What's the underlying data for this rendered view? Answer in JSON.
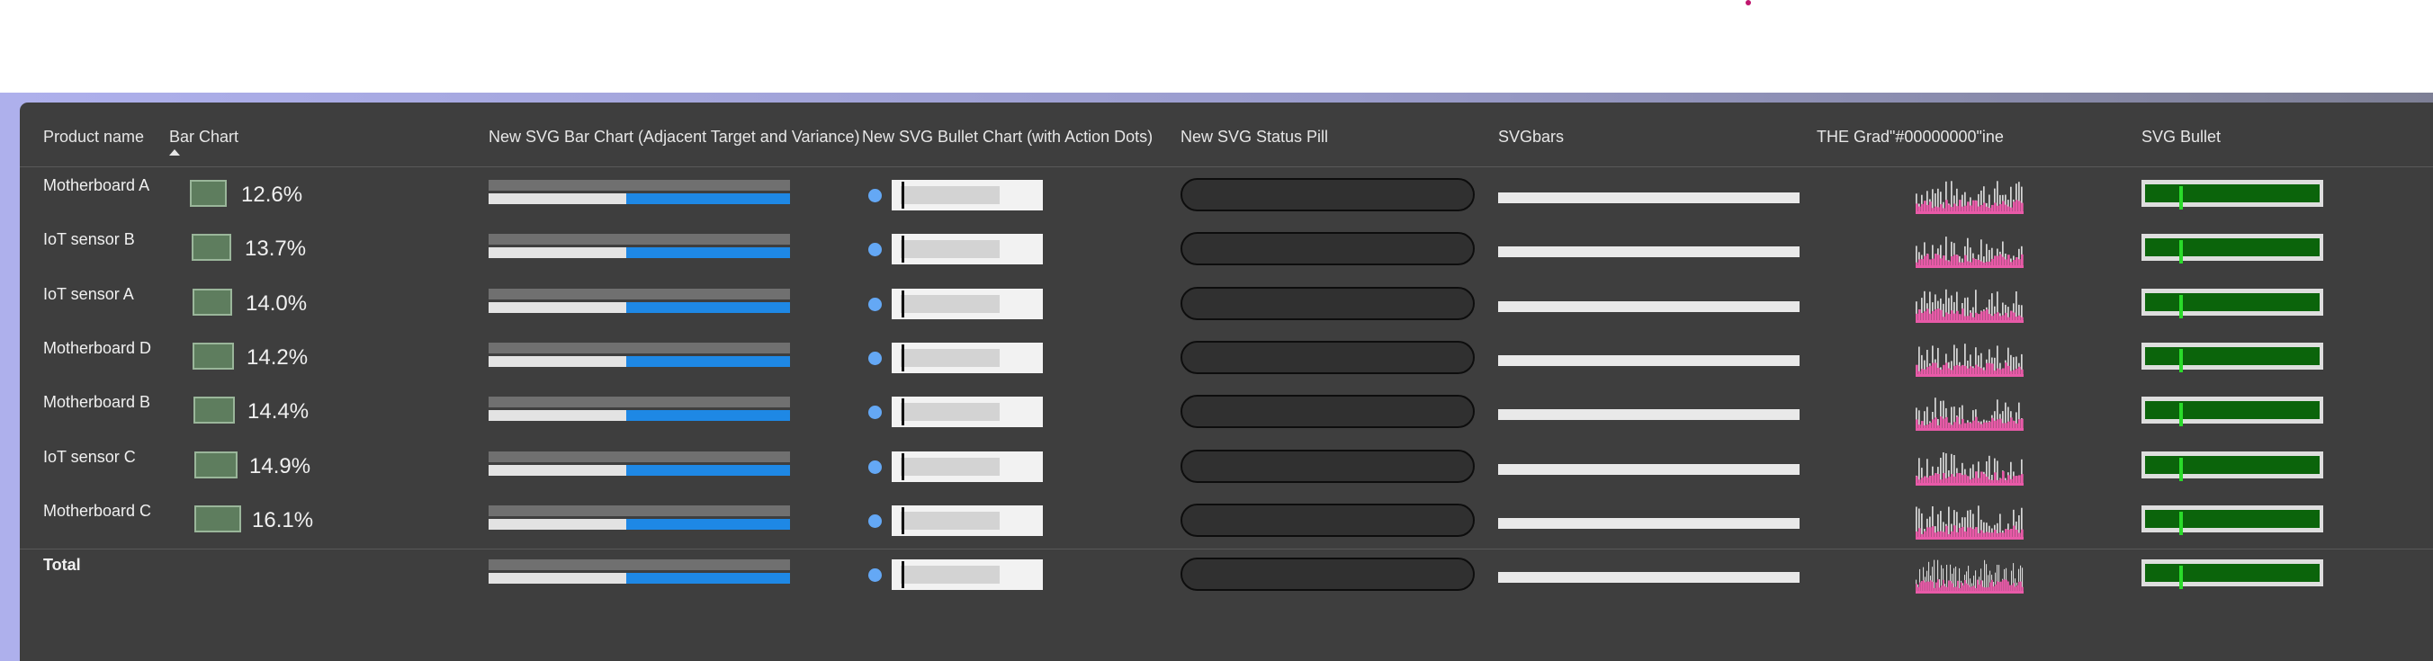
{
  "columns": {
    "product_name": "Product name",
    "bar_chart": "Bar Chart",
    "new_svg_bar_chart": "New SVG Bar Chart (Adjacent Target and Variance)",
    "new_svg_bullet_chart": "New SVG Bullet Chart (with Action Dots)",
    "new_svg_status_pill": "New SVG Status Pill",
    "svgbars": "SVGbars",
    "the_grad": "THE Grad\"#00000000\"ine",
    "svg_bullet": "SVG Bullet"
  },
  "rows": [
    {
      "name": "Motherboard A",
      "bar_pct": "12.6%",
      "bar_value": 0.126
    },
    {
      "name": "IoT sensor B",
      "bar_pct": "13.7%",
      "bar_value": 0.137
    },
    {
      "name": "IoT sensor A",
      "bar_pct": "14.0%",
      "bar_value": 0.14
    },
    {
      "name": "Motherboard D",
      "bar_pct": "14.2%",
      "bar_value": 0.142
    },
    {
      "name": "Motherboard B",
      "bar_pct": "14.4%",
      "bar_value": 0.144
    },
    {
      "name": "IoT sensor C",
      "bar_pct": "14.9%",
      "bar_value": 0.149
    },
    {
      "name": "Motherboard C",
      "bar_pct": "16.1%",
      "bar_value": 0.161
    }
  ],
  "total": {
    "name": "Total"
  },
  "colors": {
    "panel": "#3e3e3e",
    "variance_blue": "#1e88e5",
    "action_dot": "#64a8f5",
    "bullet_green": "#0b640b",
    "bullet_marker": "#2adb2a",
    "sparkline_pink": "#e85aa8"
  },
  "sort": {
    "column": "Bar Chart",
    "direction": "ascending",
    "icon": "sort-up-icon"
  }
}
